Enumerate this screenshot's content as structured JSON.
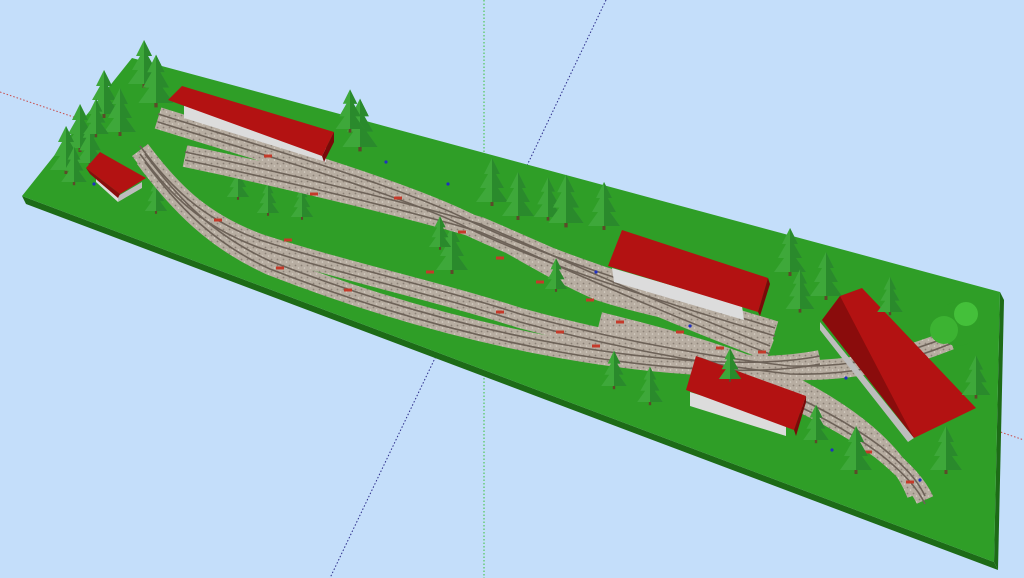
{
  "colors": {
    "background": "#c4defa",
    "baseboard_top": "#2f9e27",
    "baseboard_side": "#1d6b17",
    "ballast": "#b7ada1",
    "rail": "#6d6258",
    "sleeper_marker": "#c43a2a",
    "roof": "#b31212",
    "roof_shadow": "#7a0909",
    "wall": "#dcdcdc",
    "tree": "#3ea83a",
    "tree_dark": "#26772a",
    "axis_green": "#38c138",
    "axis_red": "#c85050",
    "axis_blue": "#2c2c8a"
  },
  "scene": {
    "objects": {
      "trees": 34,
      "buildings": 5,
      "round_bush": 1
    },
    "icons": [
      "axis-x-icon",
      "axis-y-icon",
      "axis-z-icon"
    ]
  }
}
